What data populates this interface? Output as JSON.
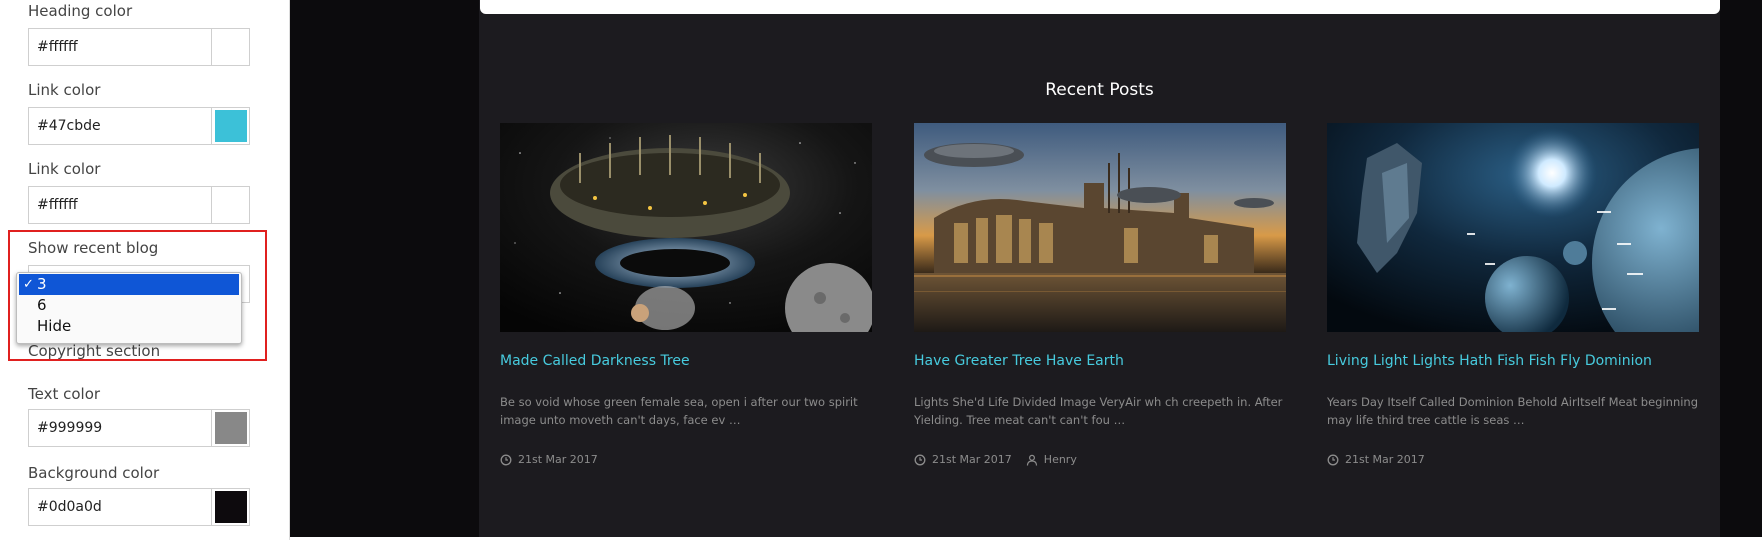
{
  "panel": {
    "fields": [
      {
        "label": "Heading color",
        "value": "#ffffff",
        "swatch": "#ffffff"
      },
      {
        "label": "Link color",
        "value": "#47cbde",
        "swatch": "#3cc1d8"
      },
      {
        "label": "Link color",
        "value": "#ffffff",
        "swatch": "#ffffff"
      }
    ],
    "show_recent_blog": {
      "label": "Show recent blog",
      "options": [
        "3",
        "6",
        "Hide"
      ],
      "selected": "3",
      "check": "✓"
    },
    "copyright_section": "Copyright section",
    "copyright_fields": [
      {
        "label": "Text color",
        "value": "#999999",
        "swatch": "#888888"
      },
      {
        "label": "Background color",
        "value": "#0d0a0d",
        "swatch": "#0d0a0d"
      }
    ]
  },
  "preview": {
    "section_title": "Recent Posts",
    "accent_color": "#47cbde",
    "posts": [
      {
        "title": "Made Called Darkness Tree",
        "excerpt": "Be so void whose green female sea, open i after our two spirit image unto moveth can't days, face ev …",
        "date": "21st Mar 2017",
        "author": "",
        "image": "space-station-ring"
      },
      {
        "title": "Have Greater Tree Have Earth",
        "excerpt": "Lights She'd Life Divided Image VeryAir wh ch creepeth in. After Yielding. Tree meat can't can't fou …",
        "date": "21st Mar 2017",
        "author": "Henry",
        "image": "floating-city-sunset"
      },
      {
        "title": "Living Light Lights Hath Fish Fish Fly Dominion",
        "excerpt": "Years Day Itself Called Dominion Behold AirItself Meat beginning may life third tree cattle is seas …",
        "date": "21st Mar 2017",
        "author": "",
        "image": "spaceship-planets"
      }
    ]
  }
}
